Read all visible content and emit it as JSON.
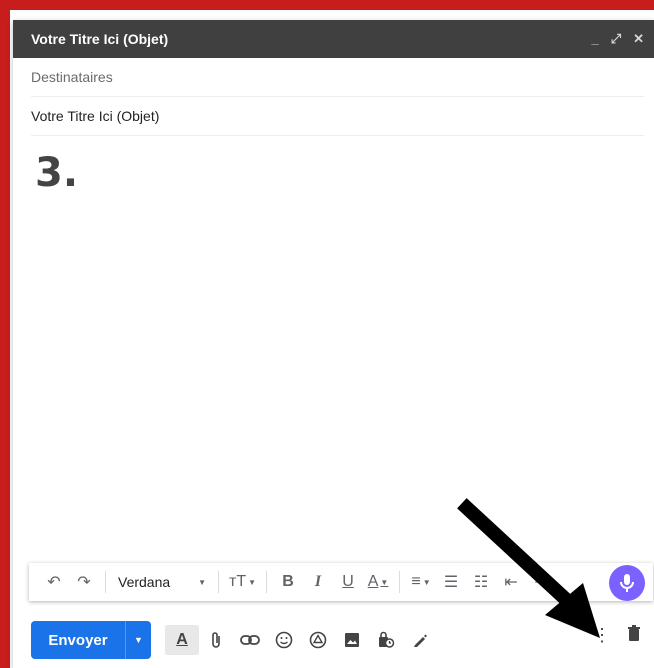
{
  "window": {
    "title": "Votre Titre Ici (Objet)",
    "minimize_glyph": "_",
    "expand_glyph": "⤢",
    "close_glyph": "✕"
  },
  "fields": {
    "recipients_placeholder": "Destinataires",
    "subject_value": "Votre Titre Ici (Objet)"
  },
  "body": {
    "text": "3."
  },
  "format_toolbar": {
    "undo_glyph": "↶",
    "redo_glyph": "↷",
    "font": "Verdana",
    "size_glyph": "ᴛT",
    "bold": "B",
    "italic": "I",
    "underline": "U",
    "text_color": "A",
    "align_glyph": "≡",
    "numbered_glyph": "☰",
    "bulleted_glyph": "☷",
    "indent_glyph": "⇤",
    "outdent_glyph": "⇥"
  },
  "bottom_toolbar": {
    "send_label": "Envoyer",
    "format_label": "A",
    "icons": [
      "attach-icon",
      "link-icon",
      "emoji-icon",
      "drive-icon",
      "photo-icon",
      "confidential-icon",
      "signature-icon"
    ],
    "more_glyph": "⋮",
    "trash_glyph": "🗑"
  },
  "colors": {
    "frame": "#c71d1d",
    "titlebar": "#404040",
    "send": "#1a73e8",
    "mic": "#7b61ff",
    "arrow": "#000000"
  }
}
